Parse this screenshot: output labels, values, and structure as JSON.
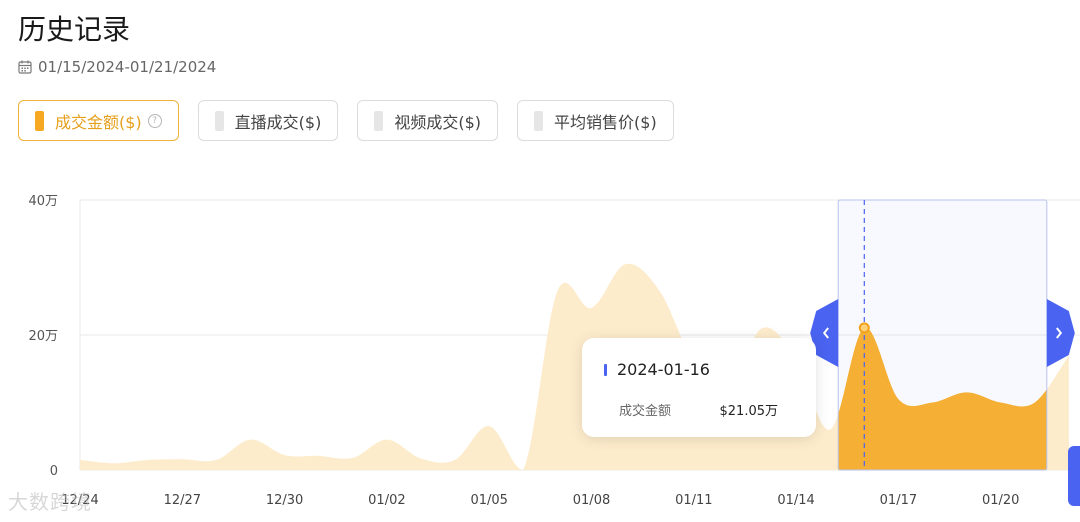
{
  "page": {
    "title": "历史记录",
    "date_range": "01/15/2024-01/21/2024"
  },
  "tabs": [
    {
      "label": "成交金额($)",
      "active": true,
      "help_icon": "question-circle-icon"
    },
    {
      "label": "直播成交($)",
      "active": false
    },
    {
      "label": "视频成交($)",
      "active": false
    },
    {
      "label": "平均销售价($)",
      "active": false
    }
  ],
  "tooltip": {
    "date": "2024-01-16",
    "label": "成交金额",
    "value": "$21.05万"
  },
  "watermark": "大数跨境",
  "colors": {
    "accent": "#f7a823",
    "area_light": "#fdeccc",
    "area_selected": "#fbb22d",
    "brush": "#4a63f0"
  },
  "chart_data": {
    "type": "area",
    "ylim": [
      0,
      400000
    ],
    "y_ticks": [
      "0",
      "20万",
      "40万"
    ],
    "x_tick_labels": [
      "12/24",
      "12/27",
      "12/30",
      "01/02",
      "01/05",
      "01/08",
      "01/11",
      "01/14",
      "01/17",
      "01/20"
    ],
    "x": [
      "12/24",
      "12/25",
      "12/26",
      "12/27",
      "12/28",
      "12/29",
      "12/30",
      "12/31",
      "01/01",
      "01/02",
      "01/03",
      "01/04",
      "01/05",
      "01/06",
      "01/07",
      "01/08",
      "01/09",
      "01/10",
      "01/11",
      "01/12",
      "01/13",
      "01/14",
      "01/15",
      "01/16",
      "01/17",
      "01/18",
      "01/19",
      "01/20",
      "01/21",
      "01/22"
    ],
    "series": [
      {
        "values": [
          15000,
          10000,
          15000,
          16000,
          15000,
          45000,
          22000,
          21000,
          18000,
          45000,
          17000,
          15000,
          65000,
          0,
          265000,
          240000,
          305000,
          265000,
          160000,
          120000,
          210000,
          165000,
          60000,
          210500,
          105000,
          100000,
          115000,
          100000,
          100000,
          170000
        ]
      }
    ],
    "selected_range": [
      "01/15",
      "01/21"
    ],
    "highlight": {
      "x": "01/16",
      "value": 210500
    },
    "grid": true
  }
}
